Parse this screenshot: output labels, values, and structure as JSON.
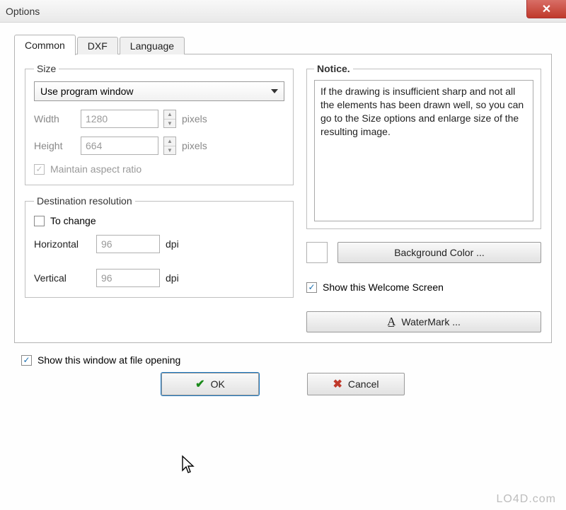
{
  "window": {
    "title": "Options"
  },
  "tabs": {
    "common": "Common",
    "dxf": "DXF",
    "language": "Language"
  },
  "size": {
    "legend": "Size",
    "mode_selected": "Use program window",
    "width_label": "Width",
    "width_value": "1280",
    "height_label": "Height",
    "height_value": "664",
    "pixels_unit": "pixels",
    "maintain_aspect_label": "Maintain aspect ratio",
    "maintain_aspect_checked": true
  },
  "destination": {
    "legend": "Destination resolution",
    "to_change_label": "To change",
    "to_change_checked": false,
    "horizontal_label": "Horizontal",
    "horizontal_value": "96",
    "vertical_label": "Vertical",
    "vertical_value": "96",
    "dpi_unit": "dpi"
  },
  "notice": {
    "legend": "Notice.",
    "text": "If the drawing is insufficient sharp and not all the elements has been drawn well, so you can go to the Size options and enlarge size of the resulting image."
  },
  "bgcolor_btn": "Background Color ...",
  "bgcolor_value": "#ffffff",
  "show_welcome_label": "Show this Welcome Screen",
  "show_welcome_checked": true,
  "watermark_btn": "WaterMark ...",
  "show_at_open_label": "Show this window at file opening",
  "show_at_open_checked": true,
  "ok_label": "OK",
  "cancel_label": "Cancel",
  "branding": "LO4D.com"
}
